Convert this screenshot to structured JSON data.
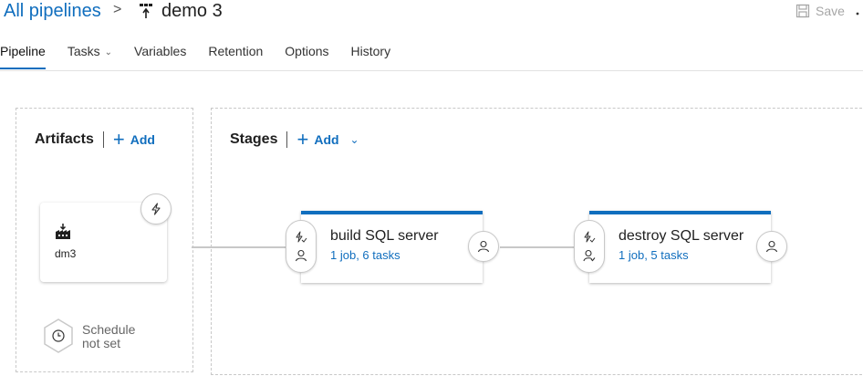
{
  "header": {
    "breadcrumb_link": "All pipelines",
    "breadcrumb_separator": ">",
    "pipeline_icon": "release-pipeline-icon",
    "title": "demo 3",
    "save_label": "Save",
    "save_icon": "save-icon"
  },
  "tabs": [
    {
      "label": "Pipeline",
      "active": true
    },
    {
      "label": "Tasks",
      "dropdown": true
    },
    {
      "label": "Variables"
    },
    {
      "label": "Retention"
    },
    {
      "label": "Options"
    },
    {
      "label": "History"
    }
  ],
  "artifacts": {
    "heading": "Artifacts",
    "add_label": "Add",
    "items": [
      {
        "name": "dm3",
        "icon": "build-artifact-icon",
        "trigger_icon": "lightning-icon"
      }
    ],
    "schedule": {
      "line1": "Schedule",
      "line2": "not set",
      "icon": "clock-icon"
    }
  },
  "stages": {
    "heading": "Stages",
    "add_label": "Add",
    "items": [
      {
        "name": "build SQL server",
        "summary": "1 job, 6 tasks"
      },
      {
        "name": "destroy SQL server",
        "summary": "1 job, 5 tasks"
      }
    ]
  },
  "colors": {
    "accent": "#106ebe",
    "border": "#c8c8c8",
    "muted": "#a6a6a6"
  }
}
